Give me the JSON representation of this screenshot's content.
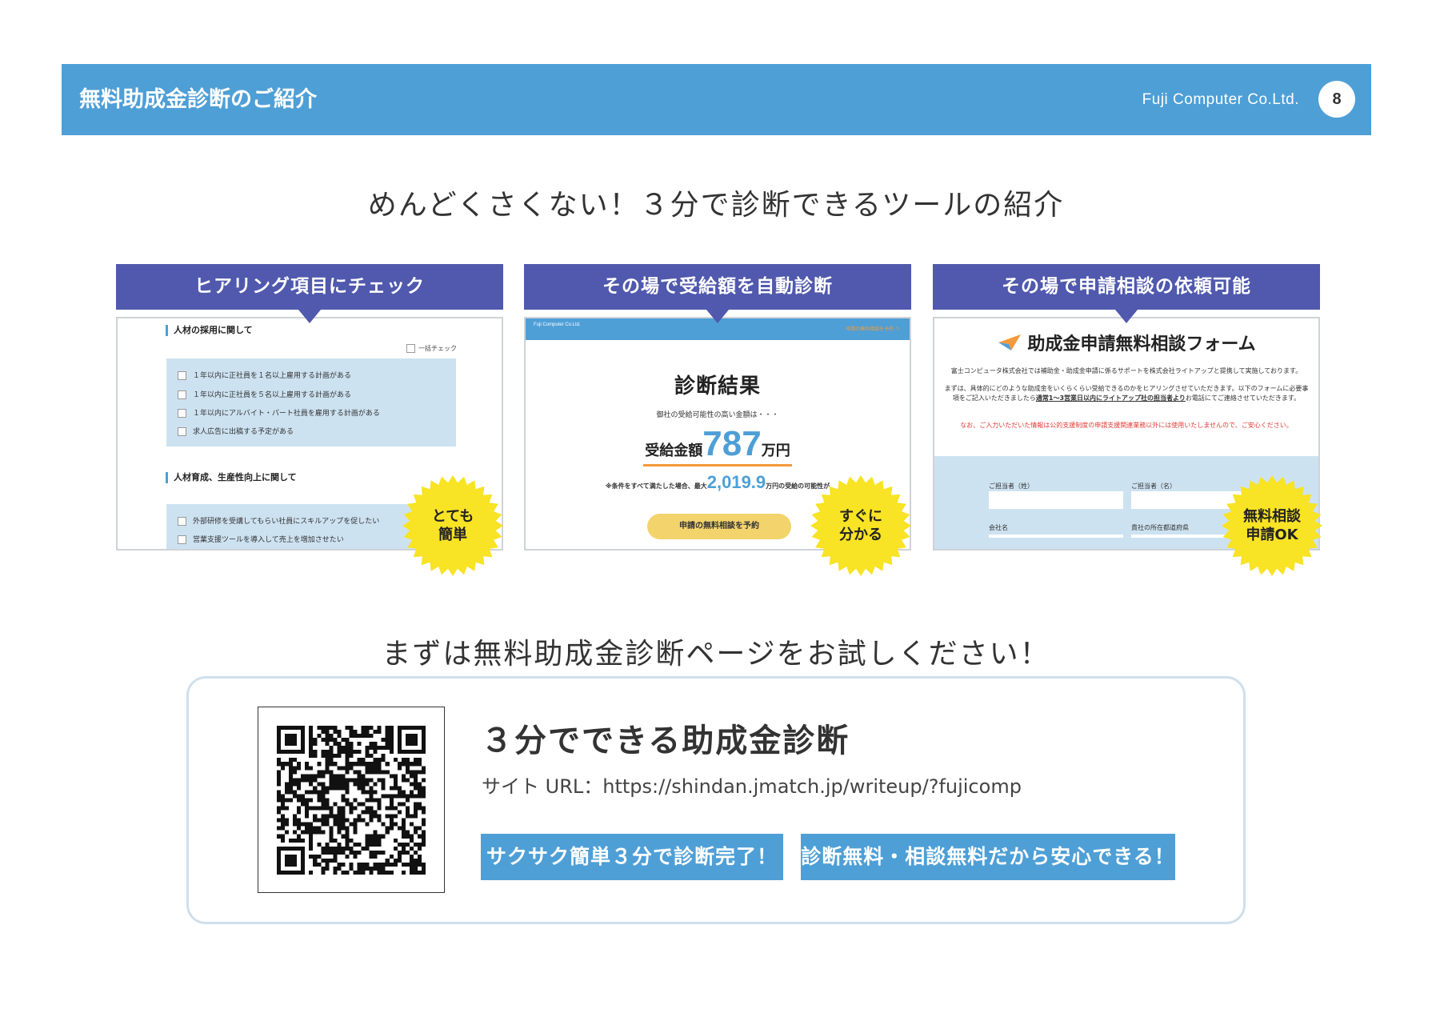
{
  "header": {
    "title": "無料助成金診断のご紹介",
    "company": "Fuji Computer Co.Ltd.",
    "page_number": "8"
  },
  "headline_top": "めんどくさくない！３分で診断できるツールの紹介",
  "headline_bottom": "まずは無料助成金診断ページをお試しください！",
  "cards": [
    {
      "title": "ヒアリング項目にチェック",
      "badge": "とても\n簡単"
    },
    {
      "title": "その場で受給額を自動診断",
      "badge": "すぐに\n分かる"
    },
    {
      "title": "その場で申請相談の依頼可能",
      "badge": "無料相談\n申請OK"
    }
  ],
  "card1": {
    "section1": "人材の採用に関して",
    "check_all": "一括チェック",
    "items1": [
      "１年以内に正社員を１名以上雇用する計画がある",
      "１年以内に正社員を５名以上雇用する計画がある",
      "１年以内にアルバイト・パート社員を雇用する計画がある",
      "求人広告に出稿する予定がある"
    ],
    "section2": "人材育成、生産性向上に関して",
    "items2": [
      "外部研修を受講してもらい社員にスキルアップを促したい",
      "営業支援ツールを導入して売上を増加させたい"
    ]
  },
  "card2": {
    "bar_logo": "Fuji Computer Co.Ltd.",
    "bar_link": "申請の無料相談を予約 ＞",
    "title": "診断結果",
    "subtitle": "御社の受給可能性の高い金額は・・・",
    "amount_label": "受給金額",
    "amount": "787",
    "amount_unit": "万円",
    "max_prefix": "※条件をすべて満たした場合、最大",
    "max_value": "2,019.9",
    "max_suffix": "万円の受給の可能性が",
    "button": "申請の無料相談を予約"
  },
  "card3": {
    "title": "助成金申請無料相談フォーム",
    "intro": "富士コンピュータ株式会社では補助金・助成金申請に係るサポートを株式会社ライトアップと提携して実施しております。",
    "body1": "まずは、具体的にどのような助成金をいくらくらい受給できるのかをヒアリングさせていただきます。以下のフォームに必要事項をご記入いただきましたら",
    "body_underline": "通常1〜3営業日以内にライトアップ社の担当者より",
    "body2": "お電話にてご連絡させていただきます。",
    "notice": "なお、ご入力いただいた情報は公的支援制度の申請支援関連業務以外には使用いたしませんので、ご安心ください。",
    "labels": [
      "ご担当者（姓）",
      "ご担当者（名）",
      "会社名",
      "貴社の所在都道府県"
    ]
  },
  "panel": {
    "title": "３分でできる助成金診断",
    "url": "サイト URL：https://shindan.jmatch.jp/writeup/?fujicomp",
    "tags": [
      "サクサク簡単３分で診断完了！",
      "診断無料・相談無料だから安心できる！"
    ]
  },
  "colors": {
    "header_blue": "#4e9fd6",
    "card_head": "#5059ad",
    "burst_yellow": "#f8e324",
    "light_blue": "#cde2f1"
  }
}
